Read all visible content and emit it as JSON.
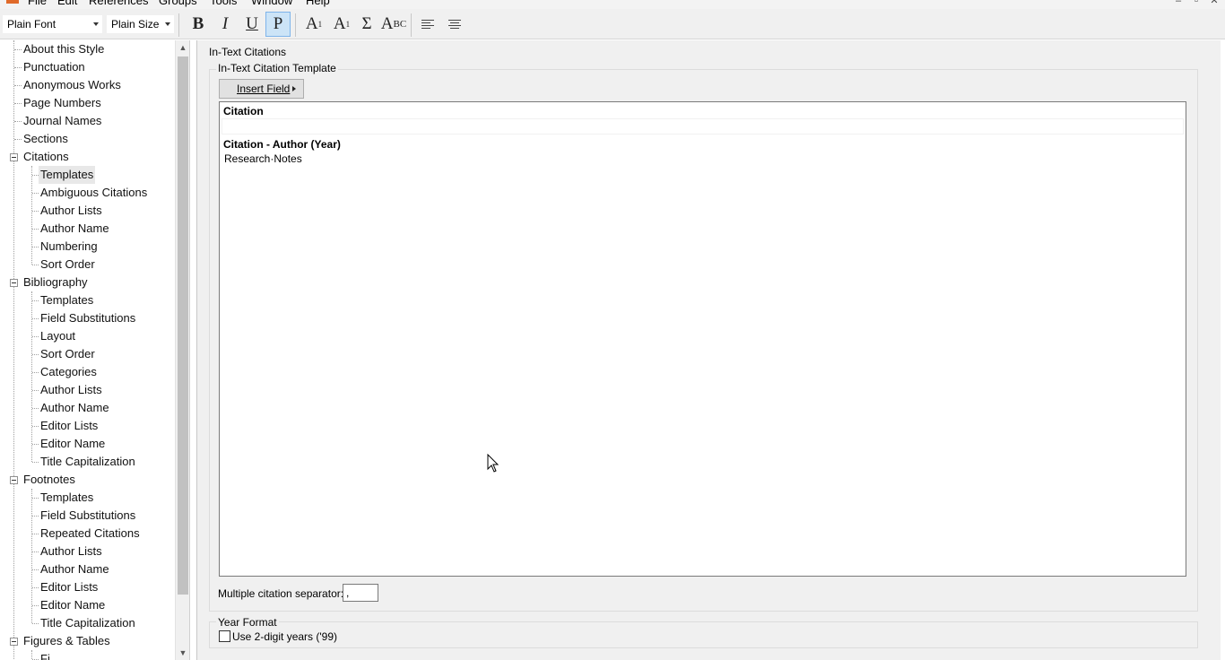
{
  "menubar": {
    "items": [
      "File",
      "Edit",
      "References",
      "Groups",
      "Tools",
      "Window",
      "Help"
    ],
    "window_controls": [
      "–",
      "▫",
      "✕"
    ]
  },
  "toolbar": {
    "font_select": "Plain Font",
    "size_select": "Plain Size",
    "bold_label": "B",
    "italic_label": "I",
    "underline_label": "U",
    "plain_label": "P",
    "superscript_label": "A",
    "superscript_mark": "1",
    "subscript_label": "A",
    "subscript_mark": "1",
    "symbol_label": "Σ",
    "smallcaps_label": "A",
    "smallcaps_mark": "BC"
  },
  "tree": {
    "items": [
      "About this Style",
      "Punctuation",
      "Anonymous Works",
      "Page Numbers",
      "Journal Names",
      "Sections",
      "Citations",
      "Templates",
      "Ambiguous Citations",
      "Author Lists",
      "Author Name",
      "Numbering",
      "Sort Order",
      "Bibliography",
      "Templates",
      "Field Substitutions",
      "Layout",
      "Sort Order",
      "Categories",
      "Author Lists",
      "Author Name",
      "Editor Lists",
      "Editor Name",
      "Title Capitalization",
      "Footnotes",
      "Templates",
      "Field Substitutions",
      "Repeated Citations",
      "Author Lists",
      "Author Name",
      "Editor Lists",
      "Editor Name",
      "Title Capitalization",
      "Figures & Tables",
      "Fi"
    ]
  },
  "content": {
    "title": "In-Text Citations",
    "template_group": "In-Text Citation Template",
    "insert_field_button": "Insert Field",
    "editor_header": "Citation",
    "template_name": "Citation - Author (Year)",
    "template_body": "Research·Notes",
    "separator_label": "Multiple citation separator:",
    "separator_value": ",",
    "year_group": "Year Format",
    "two_digit_label": "Use 2-digit years ('99)",
    "two_digit_checked": false
  }
}
